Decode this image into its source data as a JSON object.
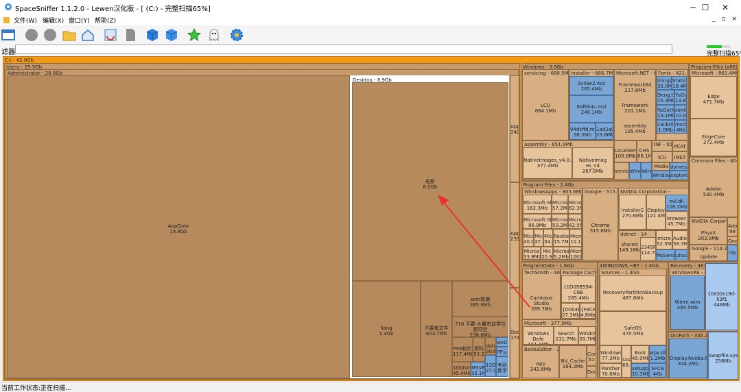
{
  "window": {
    "title": "SpaceSniffer 1.1.2.0 - Lewen汉化版 - [ (C:) - 完整扫描65%]",
    "minimize": "─",
    "maximize": "☐",
    "close": "✕",
    "mdi_controls": "_ ▫ ×"
  },
  "menu": [
    "文件(W)",
    "编辑(X)",
    "窗口(Y)",
    "帮助(Z)"
  ],
  "filter": {
    "label": "滤器",
    "value": ""
  },
  "progress": {
    "label": "完整扫描65%",
    "percent": 65,
    "color": "#22cc22"
  },
  "status": {
    "text": "当前工作状态:正在扫描..."
  },
  "map": {
    "root": "C:\\ - 42.0Gb",
    "users": "Users - 29.5Gb",
    "administrator": "Administrator - 28.8Gb",
    "appdata_name": "AppData",
    "appdata_size": "19.8Gb",
    "desktop": "Desktop - 8.9Gb",
    "dianying": "电影\n6.0Gb",
    "liang": "liang\n1.3Gb",
    "buyao": "不要看文件\n603.7Mb",
    "semdata": "sem数据\n385.9Mb",
    "row716": "716 不要-大量有益学位建项目\n238.6Mb",
    "ps": "PS6软件\n117.4Mb",
    "zl": "资料\n53.2",
    "data1": "data\n30.6M",
    "wk": "wkD",
    "pp": "PP云",
    "obtain": "1ObtUn\n45.4Mb",
    "msve": "MSVE\n35.1M",
    "xde": "12De\n27.0M",
    "kaoxue": "考研\n数学",
    "app240": "App\n240",
    "app239": "App\n239",
    "doc174": "Doc\n174",
    "windows": "Windows - 3.9Gb",
    "servicing": "servicing - 688.5Mb",
    "lcu": "LCU\n684.1Mb",
    "installer": "Installer - 666.7Mb",
    "msi1": "3c4ae2.msi\n285.4Mb",
    "msi2": "6af6b4c.msi\n240.1Mb",
    "msi3": "94dcffd.msi\n56.5Mb",
    "msi4": "1ad2a0\n23.8Mb",
    "netfw": "Microsoft.NET - 604.",
    "fw64": "Framework64\n217.6Mb",
    "fw": "Framework\n201.1Mb",
    "assembly_net": "assembly\n185.4Mb",
    "fonts": "Fonts - 421.5M",
    "mingliu": "mingLiu\n35.0M",
    "staticc": "StaticC\n18.4M",
    "deng": "Deng.ttf\n15.3Mb",
    "yugo": "YuGo\n13.8M",
    "yugoth": "YuGoth\n13.1Mb",
    "simfa": "simfa\n10.0",
    "calibri": "calibril\n1.0Mb",
    "mstmc": "mstmc\n4Kb",
    "assembly_w": "assembly - 651.9Mb",
    "ni1": "NativeImages_v4.0.303\n377.4Mb",
    "ni2": "NativeImag es_v4\n267.6Mb",
    "localserv": "LocalServi\n109.8Mb",
    "chs": "CHS\n88.1M",
    "inf": "INF - 55.",
    "pcat": "PCAT",
    "icu": "ICU",
    "imet": "IMET",
    "media": "Media -",
    "servic": "servic",
    "wind1": "Windc",
    "wind2": "Windo",
    "window3": "Window",
    "dynres": "dynres",
    "explorer": "explorer",
    "pf": "Program Files - 2.4Gb",
    "winapps": "WindowsApps - 905.6Mb",
    "msky1": "Microsoft.Sky\n162.3Mb",
    "msky2": "Microsoft.Sky\n86.9Mb",
    "m57": "Micros\n57.2Mb",
    "m62": "Micro\n62.3M",
    "m50": "Micros\n50.2M",
    "m42": "Micro\n42.5M",
    "m40": "Micr\n40.0",
    "m37": "Mic\n37.5",
    "m34": "Mic\n34.6",
    "realtek": "Realtek\n15.7Mb",
    "m10": "Micro\n10.1",
    "m33": "Micros\n33.8Mb",
    "m20": "Mic\n20.9",
    "m5": "Micros\n5.2Mb",
    "m12": "Micro\n12Kb",
    "google": "Google - 515.6M",
    "chrome": "Chrome\n515.6Mb",
    "nvidia": "NVIDIA Corporation -",
    "installer2": "Installer2\n270.6Mb",
    "display": "Display\n121.4M",
    "nvdll": "nvl.dll\n108.2Mb",
    "browser": "browser\n45.7Mb",
    "dotnet": "dotnet - 14",
    "shared": "shared\n149.1Mb",
    "v2345": "2345Pic\n114.7M",
    "micro52": "micro\n52.5M",
    "audio": "Audio\n58.3M",
    "mssen": "MsSens",
    "uhss": "uhss",
    "pfx86": "Program Files (x86) - 1.8",
    "msx86": "Microsoft - 861.4Mb",
    "edge": "Edge\n471.7Mb",
    "edgecore": "EdgeCore\n372.4Mb",
    "common": "Common Files - 606.4M",
    "adobe": "Adobe\n530.4Mb",
    "nvcorp": "NVIDIA Corpora",
    "physx": "PhysX\n203.8Mb",
    "ado": "Ado\n98",
    "qoo": "Qoo",
    "google2": "Google - 114.2M",
    "update": "Update",
    "ntp": "ntp",
    "pd": "ProgramData - 1.6Gb",
    "techsmith": "TechSmith - 401.0",
    "camtasia": "Camtasia Studio\n389.7Mb",
    "pkgcache": "Package Cache -",
    "guid1": "{1D09B594-C8B\n285.4Mb",
    "guid2": "{D004D\n27.3Mb",
    "guid3": "{F8CFE\n4.8Mb",
    "mspd": "Microsoft - 377.9Mb",
    "wdef": "Windows Defe\n161.1Mb",
    "search": "Search\n131.7Mb",
    "windows39": "Windows\n39.7Mb",
    "baidu": "BaiduEditor - 243.",
    "app242": "App\n242.6Mb",
    "nvcache": "NV_Cache\n164.2Mb",
    "com": "Com\n51",
    "dov": "Dov",
    "winbt": "$WINDOWS.~BT - 1.4Gb",
    "sources": "Sources - 1.3Gb",
    "recovery": "RecoveryPartitionBackup\n487.6Mb",
    "safeos": "SafeOS\n470.5Mb",
    "windows1": "Windows1\n77.3Mb",
    "sxs": "sxs\n69.7",
    "boot": "Boot\n45.0Mb",
    "wpx": "wpx.dll\n1.2Mb",
    "panther": "Panther\n70.6Mb",
    "setup": "setuppl\n10.3Mb",
    "sfcn": "SFCN\n4Kb",
    "recovery_top": "Recovery - 487.6",
    "winre": "WindowsRE - 48",
    "winrewim": "Winre.wim\n484.5Mb",
    "guid4": "{0d32cc9d-53f1\n448Mb",
    "drvpath": "DrvPath - 345.2Mb",
    "displaynv": "Display.Nvidia.Ne\n344.2Mb",
    "swapfile": "swapfile.sys\n256Mb"
  }
}
